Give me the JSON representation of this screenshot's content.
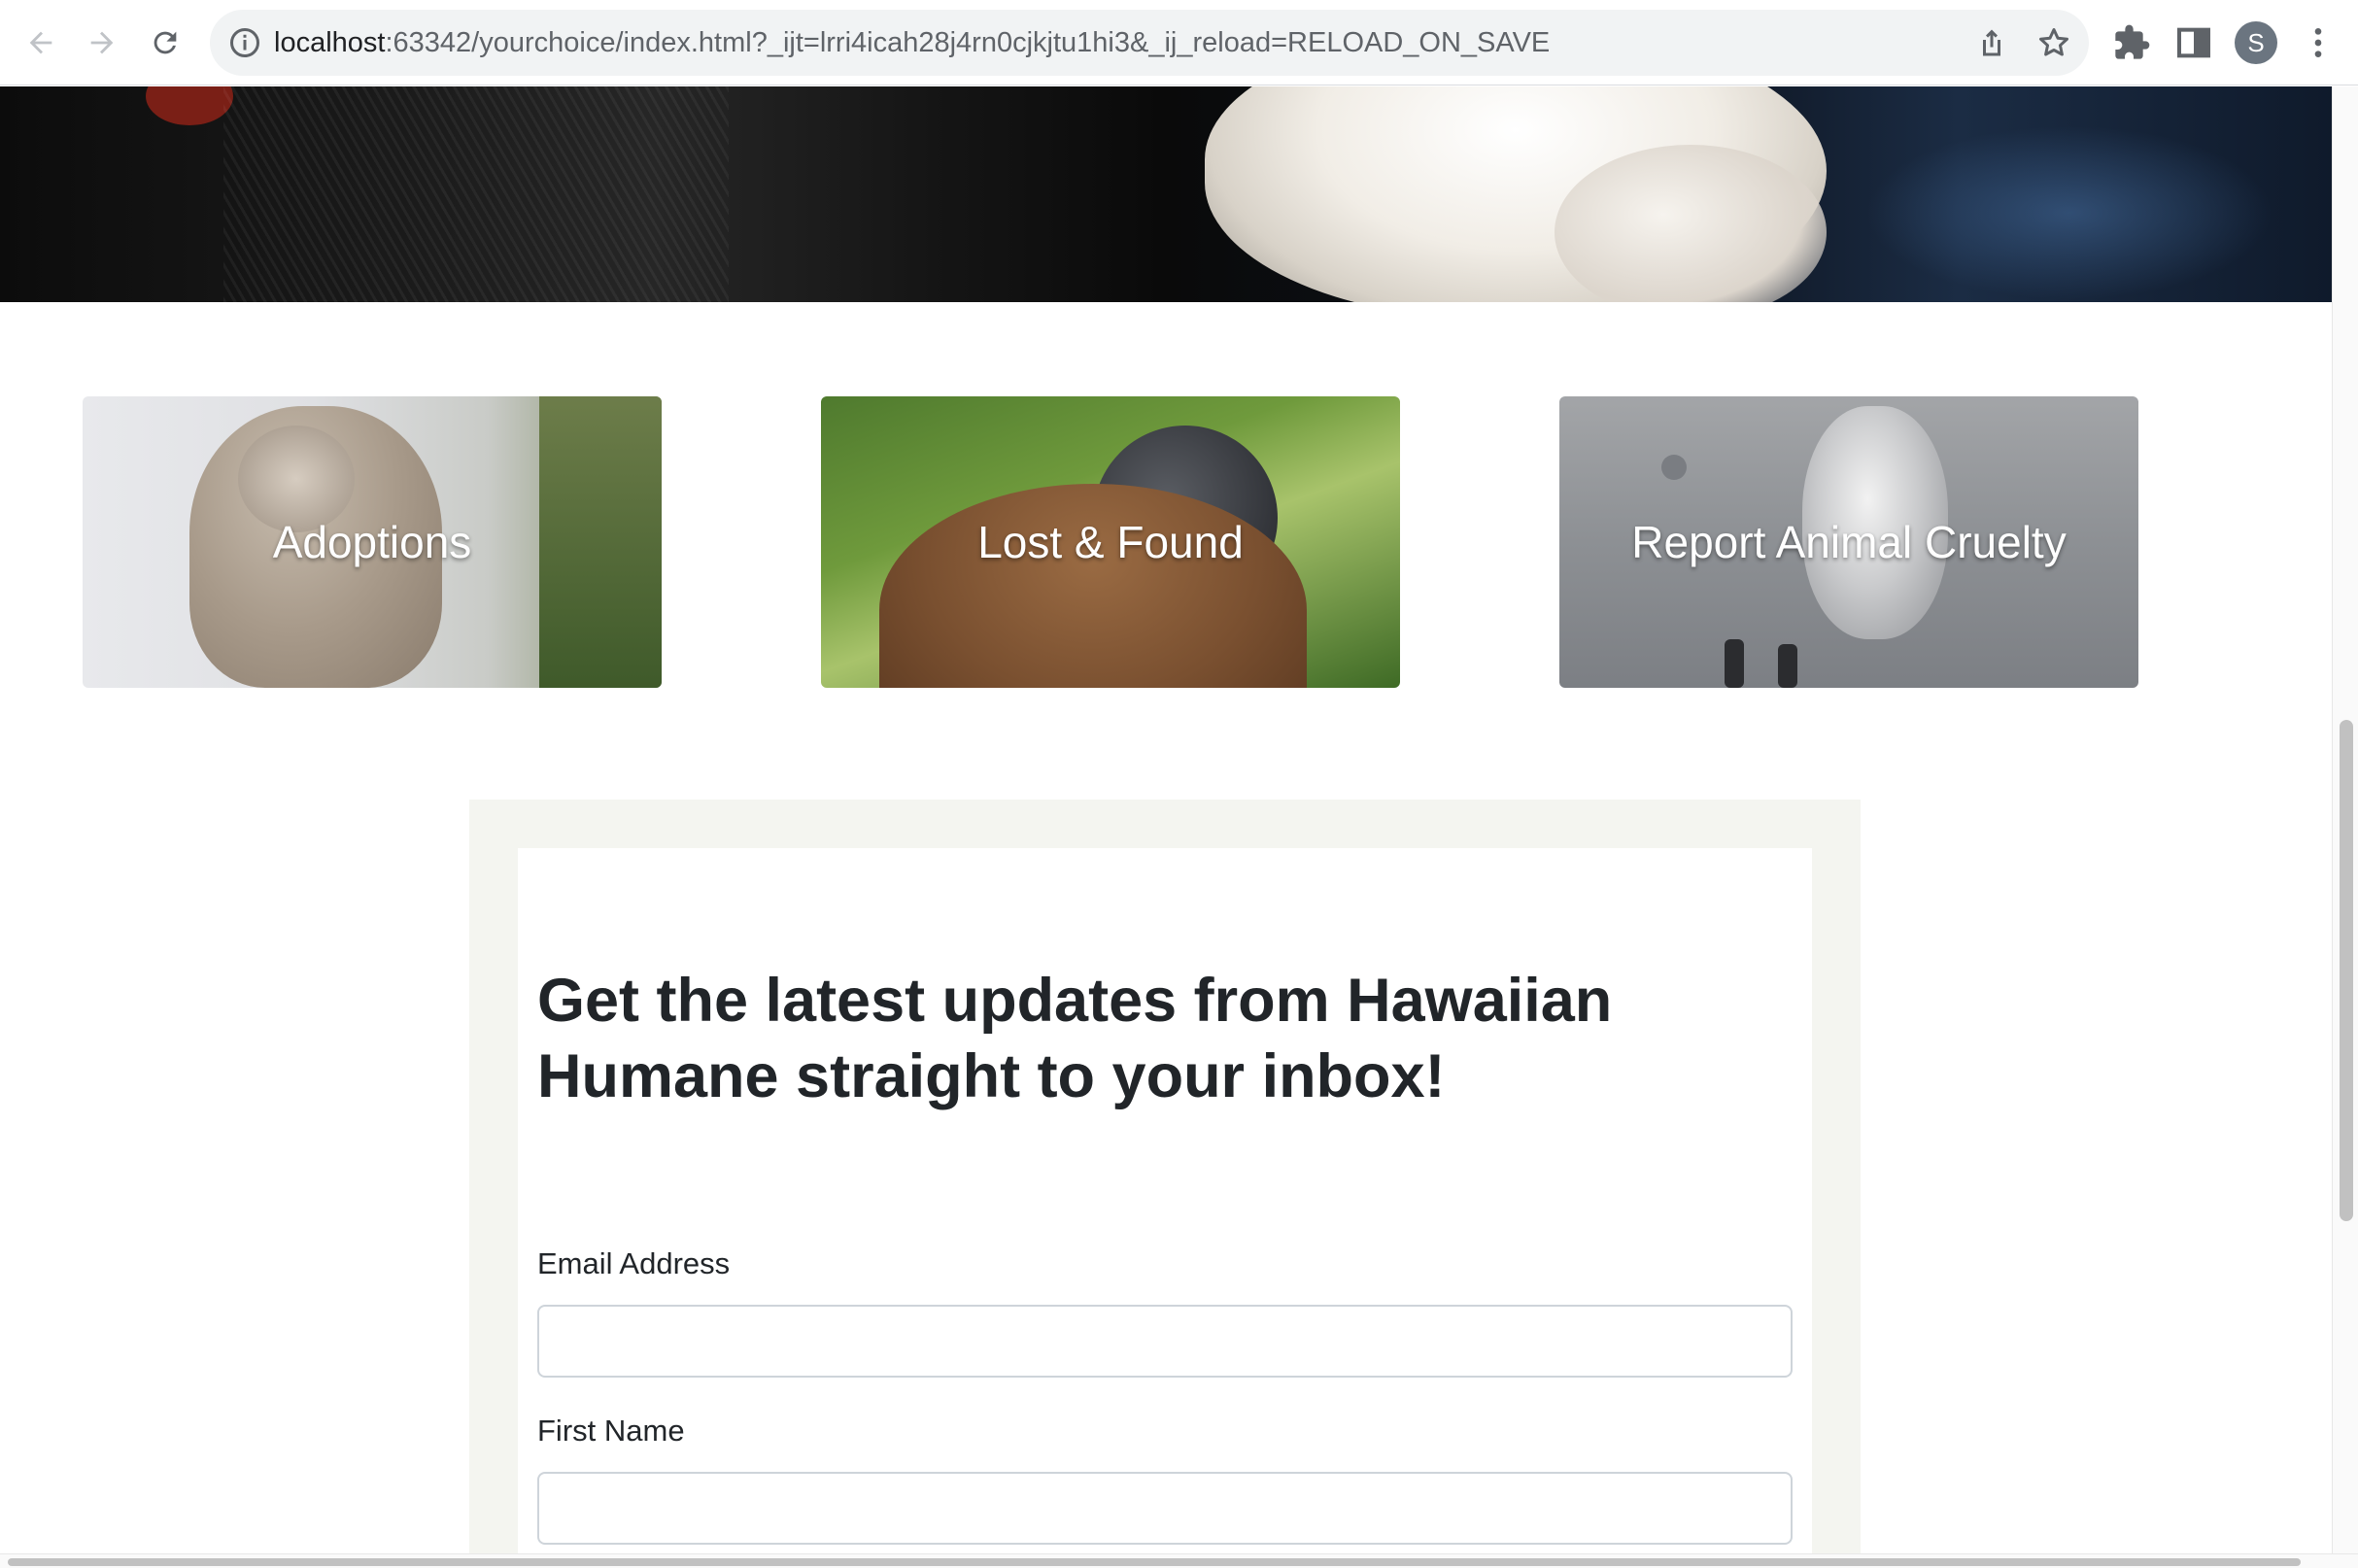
{
  "browser": {
    "url_host": "localhost",
    "url_rest": ":63342/yourchoice/index.html?_ijt=lrri4icah28j4rn0cjkjtu1hi3&_ij_reload=RELOAD_ON_SAVE",
    "profile_initial": "S",
    "icons": [
      "back-arrow-icon",
      "forward-arrow-icon",
      "reload-icon",
      "site-info-icon",
      "share-icon",
      "bookmark-star-icon",
      "extensions-puzzle-icon",
      "side-panel-icon",
      "more-vert-icon"
    ]
  },
  "cards": [
    {
      "label": "Adoptions"
    },
    {
      "label": "Lost & Found"
    },
    {
      "label": "Report Animal Cruelty"
    }
  ],
  "newsletter": {
    "title": "Get the latest updates from Hawaiian Humane straight to your inbox!",
    "fields": [
      {
        "label": "Email Address",
        "value": ""
      },
      {
        "label": "First Name",
        "value": ""
      }
    ]
  },
  "colors": {
    "text": "#212529",
    "newsletter_bg": "#f4f5f0",
    "input_border": "#ced4da"
  }
}
